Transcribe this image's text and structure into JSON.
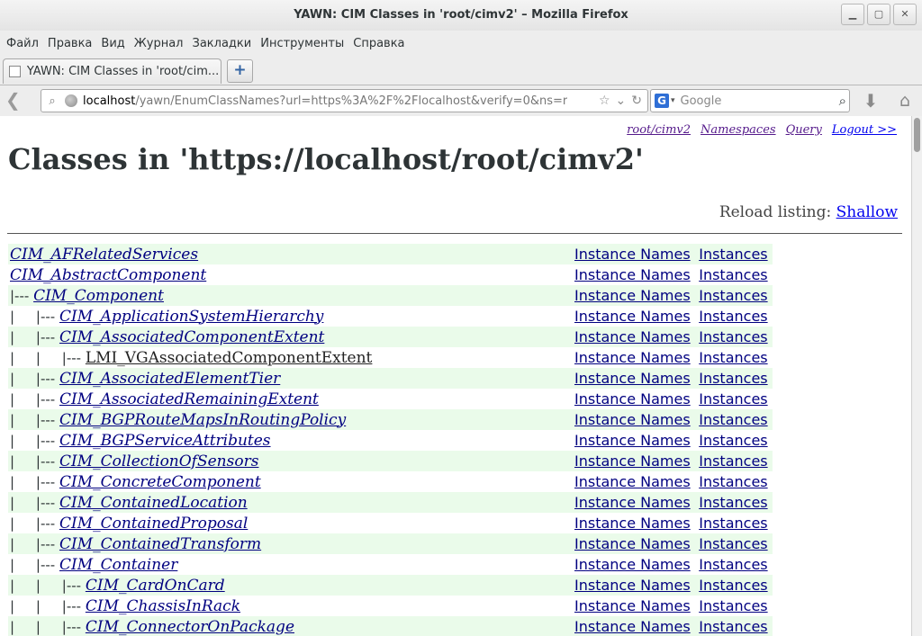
{
  "window": {
    "title": "YAWN: CIM Classes in 'root/cimv2' – Mozilla Firefox",
    "controls": [
      "minimize-icon",
      "maximize-icon",
      "close-icon"
    ]
  },
  "menu": [
    "Файл",
    "Правка",
    "Вид",
    "Журнал",
    "Закладки",
    "Инструменты",
    "Справка"
  ],
  "tab": {
    "title": "YAWN: CIM Classes in 'root/cim..."
  },
  "newtab_label": "+",
  "url": {
    "host": "localhost",
    "rest": "/yawn/EnumClassNames?url=https%3A%2F%2Flocalhost&verify=0&ns=r"
  },
  "search": {
    "engine": "G",
    "placeholder": "Google"
  },
  "page": {
    "toplinks": [
      "root/cimv2",
      "Namespaces",
      "Query",
      "Logout >>"
    ],
    "heading": "Classes in 'https://localhost/root/cimv2'",
    "reload_label": "Reload listing:",
    "reload_link": "Shallow",
    "instance_names_label": "Instance Names",
    "instances_label": "Instances",
    "rows": [
      {
        "prefix": "",
        "name": "CIM_AFRelatedServices",
        "italic": true
      },
      {
        "prefix": "",
        "name": "CIM_AbstractComponent",
        "italic": true
      },
      {
        "prefix": "|--- ",
        "name": "CIM_Component",
        "italic": true
      },
      {
        "prefix": "|     |--- ",
        "name": "CIM_ApplicationSystemHierarchy",
        "italic": true
      },
      {
        "prefix": "|     |--- ",
        "name": "CIM_AssociatedComponentExtent",
        "italic": true
      },
      {
        "prefix": "|     |     |--- ",
        "name": "LMI_VGAssociatedComponentExtent",
        "italic": false
      },
      {
        "prefix": "|     |--- ",
        "name": "CIM_AssociatedElementTier",
        "italic": true
      },
      {
        "prefix": "|     |--- ",
        "name": "CIM_AssociatedRemainingExtent",
        "italic": true
      },
      {
        "prefix": "|     |--- ",
        "name": "CIM_BGPRouteMapsInRoutingPolicy",
        "italic": true
      },
      {
        "prefix": "|     |--- ",
        "name": "CIM_BGPServiceAttributes",
        "italic": true
      },
      {
        "prefix": "|     |--- ",
        "name": "CIM_CollectionOfSensors",
        "italic": true
      },
      {
        "prefix": "|     |--- ",
        "name": "CIM_ConcreteComponent",
        "italic": true
      },
      {
        "prefix": "|     |--- ",
        "name": "CIM_ContainedLocation",
        "italic": true
      },
      {
        "prefix": "|     |--- ",
        "name": "CIM_ContainedProposal",
        "italic": true
      },
      {
        "prefix": "|     |--- ",
        "name": "CIM_ContainedTransform",
        "italic": true
      },
      {
        "prefix": "|     |--- ",
        "name": "CIM_Container",
        "italic": true
      },
      {
        "prefix": "|     |     |--- ",
        "name": "CIM_CardOnCard",
        "italic": true
      },
      {
        "prefix": "|     |     |--- ",
        "name": "CIM_ChassisInRack",
        "italic": true
      },
      {
        "prefix": "|     |     |--- ",
        "name": "CIM_ConnectorOnPackage",
        "italic": true
      }
    ]
  }
}
